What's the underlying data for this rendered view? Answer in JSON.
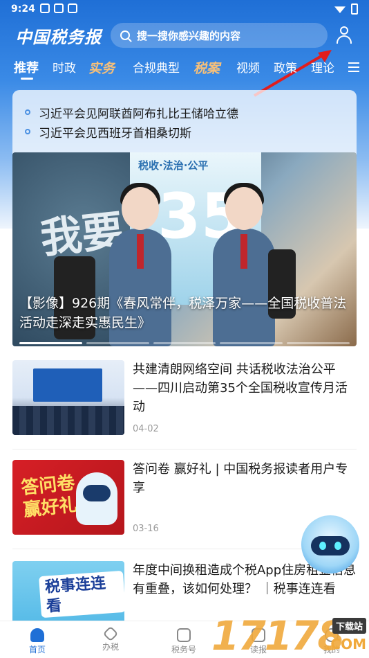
{
  "status": {
    "time": "9:24"
  },
  "header": {
    "logo": "中国税务报",
    "search_placeholder": "搜一搜你感兴趣的内容"
  },
  "tabs": [
    "推荐",
    "时政",
    "实务",
    "合规典型",
    "税案",
    "视频",
    "政策",
    "理论"
  ],
  "ticker": [
    "习近平会见阿联酋阿布扎比王储哈立德",
    "习近平会见西班牙首相桑切斯"
  ],
  "hero": {
    "caption": "【影像】926期《春风常伴，税泽万家——全国税收普法活动走深走实惠民生》",
    "banner_text": "税收·法治·公平",
    "big_number": "35",
    "wall_text": "我要"
  },
  "articles": [
    {
      "title": "共建清朗网络空间 共话税收法治公平——四川启动第35个全国税收宣传月活动",
      "date": "04-02"
    },
    {
      "title": "答问卷 赢好礼 | 中国税务报读者用户专享",
      "date": "03-16",
      "thumb_text": "答问卷赢好礼"
    },
    {
      "title": "年度中间换租造成个税App住房租金信息有重叠，该如何处理？ ｜税事连连看",
      "thumb_text": "税事连连看"
    }
  ],
  "bottom_nav": [
    {
      "label": "首页",
      "active": true
    },
    {
      "label": "办税",
      "active": false
    },
    {
      "label": "税务号",
      "active": false
    },
    {
      "label": "读报",
      "active": false
    },
    {
      "label": "我的",
      "active": false
    }
  ],
  "watermark": {
    "digits": "17178",
    "top": "下载站",
    "com": ".COM"
  },
  "colors": {
    "brand_blue": "#1f6fd6",
    "special_tab": "#f6c07a"
  }
}
